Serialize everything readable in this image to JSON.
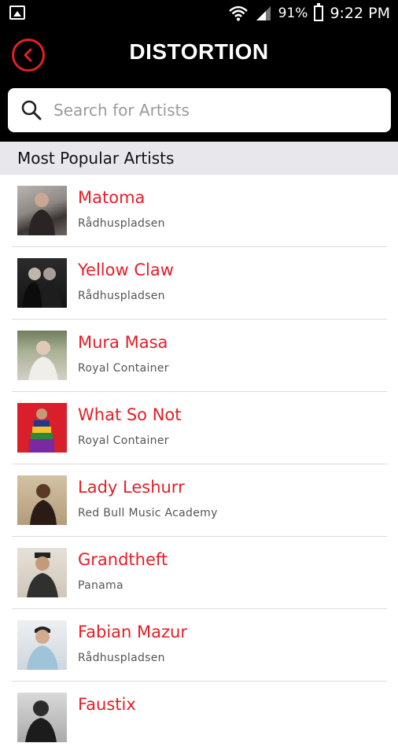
{
  "status_bar": {
    "battery_percent": "91%",
    "time": "9:22 PM",
    "icons": [
      "image-icon",
      "wifi-icon",
      "signal-icon",
      "battery-charging-icon"
    ]
  },
  "header": {
    "title": "DISTORTION",
    "accent_color": "#e41e26"
  },
  "search": {
    "placeholder": "Search for Artists",
    "value": ""
  },
  "section": {
    "title": "Most Popular Artists"
  },
  "artists": [
    {
      "name": "Matoma",
      "venue": "Rådhuspladsen"
    },
    {
      "name": "Yellow Claw",
      "venue": "Rådhuspladsen"
    },
    {
      "name": "Mura Masa",
      "venue": "Royal Container"
    },
    {
      "name": "What So Not",
      "venue": "Royal Container"
    },
    {
      "name": "Lady Leshurr",
      "venue": "Red Bull Music Academy"
    },
    {
      "name": "Grandtheft",
      "venue": "Panama"
    },
    {
      "name": "Fabian Mazur",
      "venue": "Rådhuspladsen"
    },
    {
      "name": "Faustix",
      "venue": ""
    }
  ]
}
